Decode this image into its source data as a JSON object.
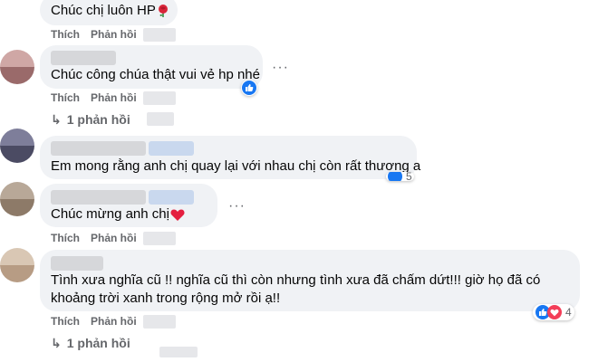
{
  "comments": [
    {
      "text": "Chúc chị luôn HP"
    },
    {
      "text": "Chúc công chúa thật vui vẻ hp nhé"
    },
    {
      "text": "Em mong rằng anh chị quay lại với nhau chị còn rất thương a"
    },
    {
      "text": "Chúc mừng anh chị"
    },
    {
      "text_line1": "Tình xưa nghĩa cũ !! nghĩa cũ thì còn nhưng tình xưa đã chấm dứt!!! giờ họ đã có",
      "text_line2": "khoảng trời xanh trong rộng mở rồi ạ!!"
    }
  ],
  "actions": {
    "like": "Thích",
    "reply": "Phản hồi"
  },
  "replies_label": "1 phản hồi",
  "reaction_counts": {
    "c5": "4",
    "c3_partial": "5"
  },
  "more_symbol": "···",
  "colors": {
    "bubble": "#f0f2f5",
    "like": "#1877f2",
    "love": "#f33e58",
    "meta": "#65676b"
  },
  "icons": [
    "rose-emoji-icon",
    "red-heart-emoji-icon",
    "like-reaction-icon",
    "love-reaction-icon",
    "reply-arrow-icon",
    "more-options-icon"
  ]
}
